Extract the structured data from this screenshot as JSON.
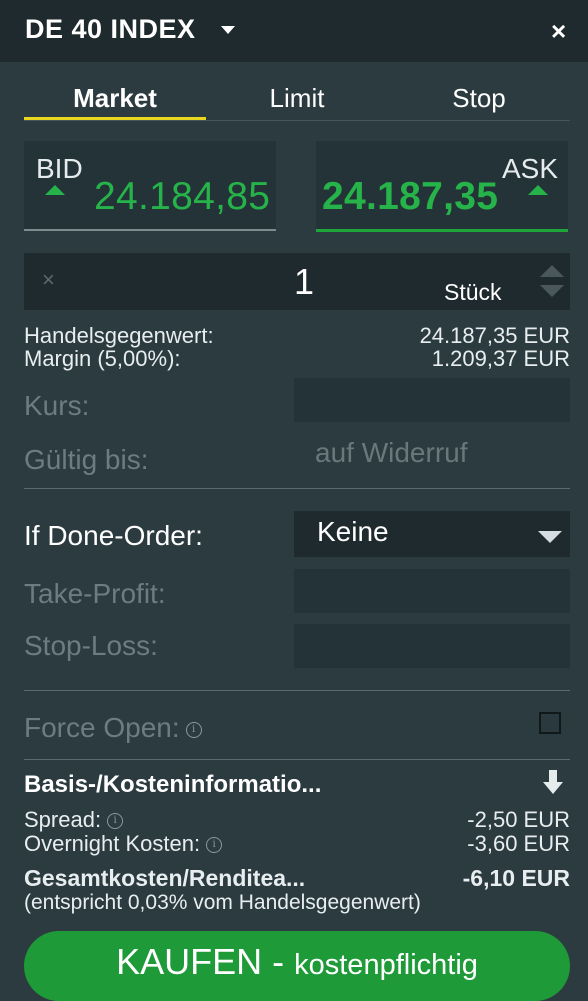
{
  "header": {
    "title": "DE 40 INDEX",
    "close_label": "×"
  },
  "tabs": [
    {
      "label": "Market",
      "active": true
    },
    {
      "label": "Limit",
      "active": false
    },
    {
      "label": "Stop",
      "active": false
    }
  ],
  "quotes": {
    "bid_label": "BID",
    "bid_price": "24.184,85",
    "ask_label": "ASK",
    "ask_price": "24.187,35"
  },
  "quantity": {
    "clear_label": "×",
    "value": "1",
    "unit": "Stück"
  },
  "summary": {
    "handelsgegenwert_label": "Handelsgegenwert:",
    "handelsgegenwert_value": "24.187,35 EUR",
    "margin_label": "Margin (5,00%):",
    "margin_value": "1.209,37 EUR"
  },
  "fields": {
    "kurs_label": "Kurs:",
    "gueltig_label": "Gültig bis:",
    "gueltig_value": "auf Widerruf",
    "ifdone_label": "If Done-Order:",
    "ifdone_value": "Keine",
    "takeprofit_label": "Take-Profit:",
    "stoploss_label": "Stop-Loss:",
    "forceopen_label": "Force Open:",
    "forceopen_checked": false
  },
  "costs": {
    "title": "Basis-/Kosteninformatio...",
    "spread_label": "Spread:",
    "spread_value": "-2,50 EUR",
    "overnight_label": "Overnight Kosten:",
    "overnight_value": "-3,60 EUR",
    "total_label": "Gesamtkosten/Renditea...",
    "total_value": "-6,10 EUR",
    "note": "(entspricht 0,03% vom Handelsgegenwert)"
  },
  "buy_button": {
    "label": "KAUFEN",
    "separator": " - ",
    "sub": "kostenpflichtig"
  },
  "colors": {
    "accent_green": "#26b44a",
    "tab_underline": "#e8d61f",
    "button_green": "#1f9a38"
  }
}
